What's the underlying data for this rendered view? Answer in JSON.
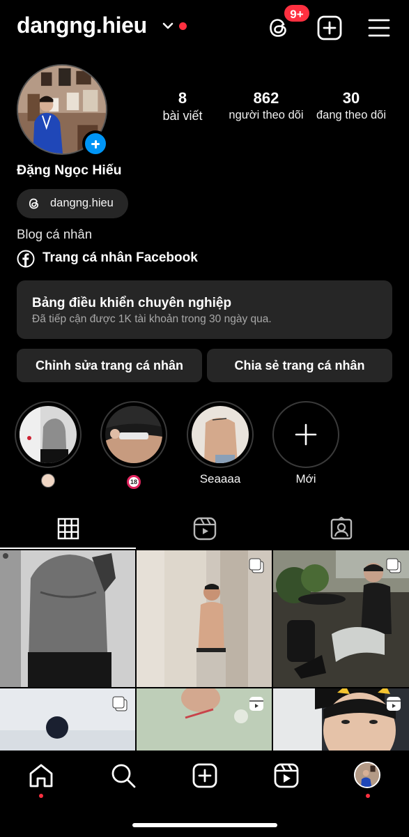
{
  "header": {
    "username": "dangng.hieu",
    "notification_badge": "9+",
    "accent_red": "#ff3040"
  },
  "profile": {
    "full_name": "Đặng Ngọc Hiếu",
    "stats": [
      {
        "value": "8",
        "label": "bài viết"
      },
      {
        "value": "862",
        "label": "người theo dõi"
      },
      {
        "value": "30",
        "label": "đang theo dõi"
      }
    ],
    "threads_handle": "dangng.hieu",
    "bio": "Blog cá nhân",
    "facebook_link": "Trang cá nhân Facebook"
  },
  "dashboard": {
    "title": "Bảng điều khiển chuyên nghiệp",
    "subtitle": "Đã tiếp cận được 1K tài khoản trong 30 ngày qua."
  },
  "actions": {
    "edit_label": "Chỉnh sửa trang cá nhân",
    "share_label": "Chia sẻ trang cá nhân"
  },
  "highlights": [
    {
      "label": "",
      "icon": "face-emoji"
    },
    {
      "label": "",
      "icon": "no-under-18-emoji"
    },
    {
      "label": "Seaaaa"
    },
    {
      "label": "Mới",
      "icon": "plus-icon"
    }
  ],
  "tabs": [
    {
      "icon": "grid-icon",
      "active": true
    },
    {
      "icon": "reels-icon",
      "active": false
    },
    {
      "icon": "tagged-icon",
      "active": false
    }
  ],
  "grid_indicators": [
    "none",
    "carousel",
    "carousel",
    "carousel",
    "reel",
    "reel"
  ],
  "bottom_nav": [
    "home-icon",
    "search-icon",
    "create-icon",
    "reels-icon",
    "profile-avatar"
  ],
  "colors": {
    "primary_blue": "#0095f6",
    "surface": "#262626",
    "background": "#000000"
  }
}
